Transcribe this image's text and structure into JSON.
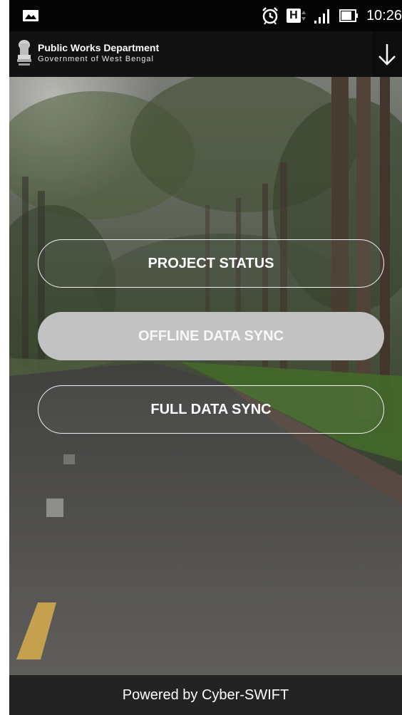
{
  "status_bar": {
    "time": "10:26",
    "network": "H",
    "icons": [
      "image-icon",
      "alarm-icon",
      "network-h-icon",
      "signal-icon",
      "battery-icon"
    ]
  },
  "app_header": {
    "title": "Public Works Department",
    "subtitle": "Government of West Bengal",
    "emblem": "state-emblem-icon",
    "action_icon": "arrow-down-icon"
  },
  "menu": {
    "project_status": "PROJECT STATUS",
    "offline_data_sync": "OFFLINE DATA SYNC",
    "full_data_sync": "FULL DATA SYNC"
  },
  "footer": {
    "powered_by": "Powered by Cyber-SWIFT"
  },
  "colors": {
    "status_bar_bg": "#050505",
    "header_bg": "#121212",
    "footer_bg": "#232323",
    "filled_button_bg": "#c2c2c2",
    "button_text": "#ffffff"
  }
}
